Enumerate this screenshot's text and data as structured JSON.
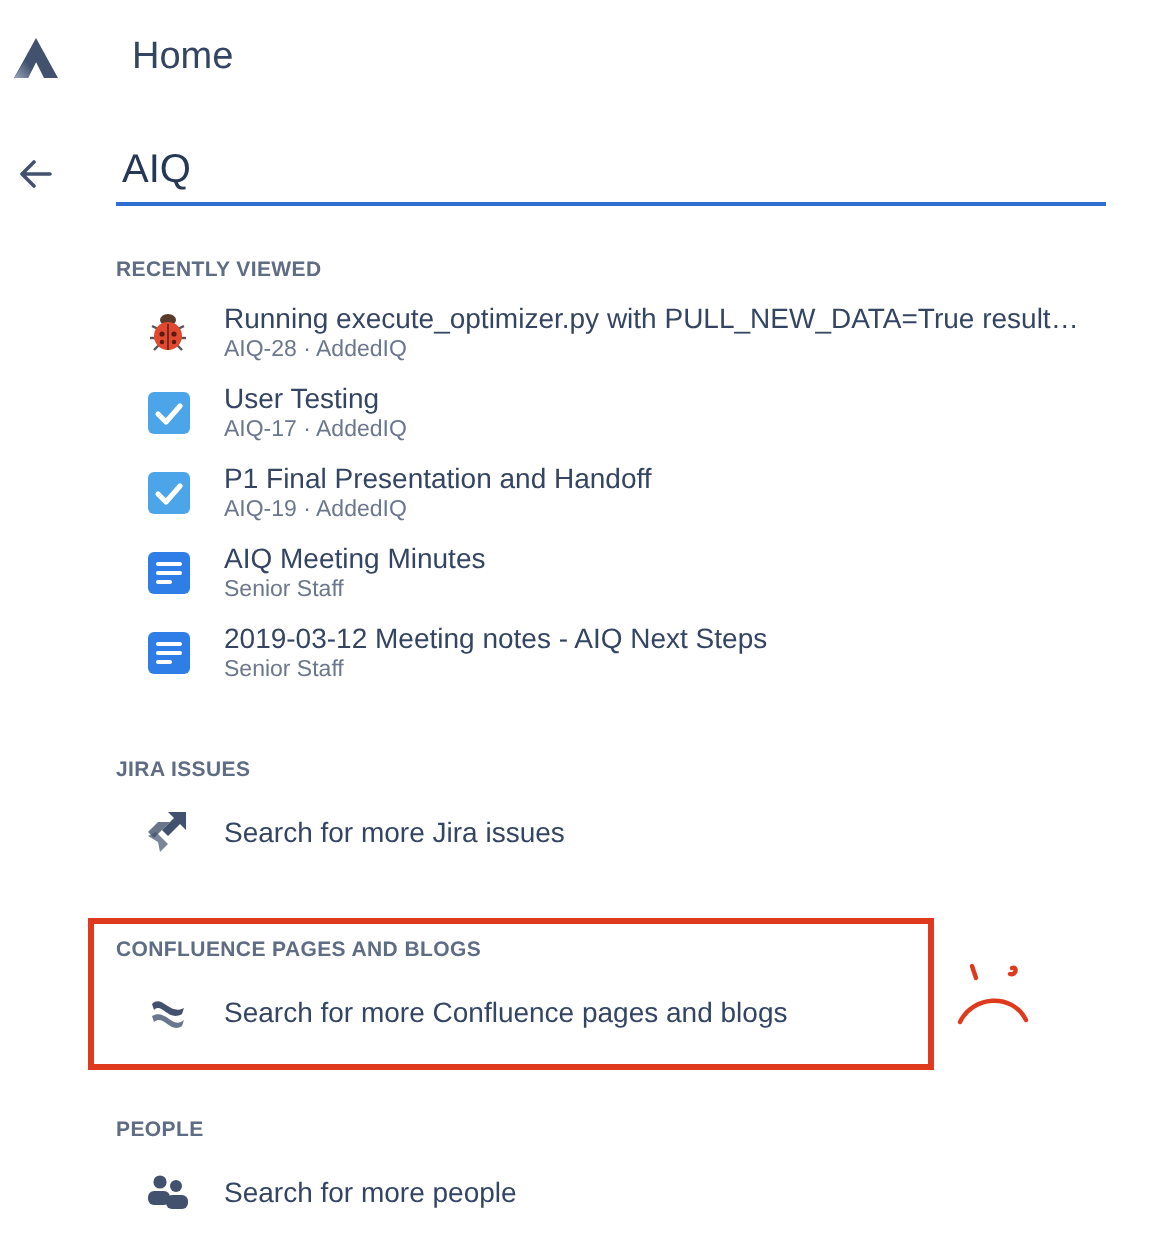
{
  "header": {
    "title": "Home"
  },
  "search": {
    "value": "AIQ"
  },
  "sections": [
    {
      "heading": "RECENTLY VIEWED",
      "highlighted": false,
      "items": [
        {
          "kind": "bug",
          "title": "Running execute_optimizer.py with PULL_NEW_DATA=True result…",
          "subtitle": "AIQ-28 · AddedIQ"
        },
        {
          "kind": "task",
          "title": "User Testing",
          "subtitle": "AIQ-17 · AddedIQ"
        },
        {
          "kind": "task",
          "title": "P1 Final Presentation and Handoff",
          "subtitle": "AIQ-19 · AddedIQ"
        },
        {
          "kind": "page",
          "title": "AIQ Meeting Minutes",
          "subtitle": "Senior Staff"
        },
        {
          "kind": "page",
          "title": "2019-03-12 Meeting notes - AIQ Next Steps",
          "subtitle": "Senior Staff"
        }
      ]
    },
    {
      "heading": "JIRA ISSUES",
      "highlighted": false,
      "items": [
        {
          "kind": "jira",
          "title": "Search for more Jira issues"
        }
      ]
    },
    {
      "heading": "CONFLUENCE PAGES AND BLOGS",
      "highlighted": true,
      "items": [
        {
          "kind": "confluence",
          "title": "Search for more Confluence pages and blogs"
        }
      ]
    },
    {
      "heading": "PEOPLE",
      "highlighted": false,
      "items": [
        {
          "kind": "people",
          "title": "Search for more people"
        }
      ]
    }
  ]
}
